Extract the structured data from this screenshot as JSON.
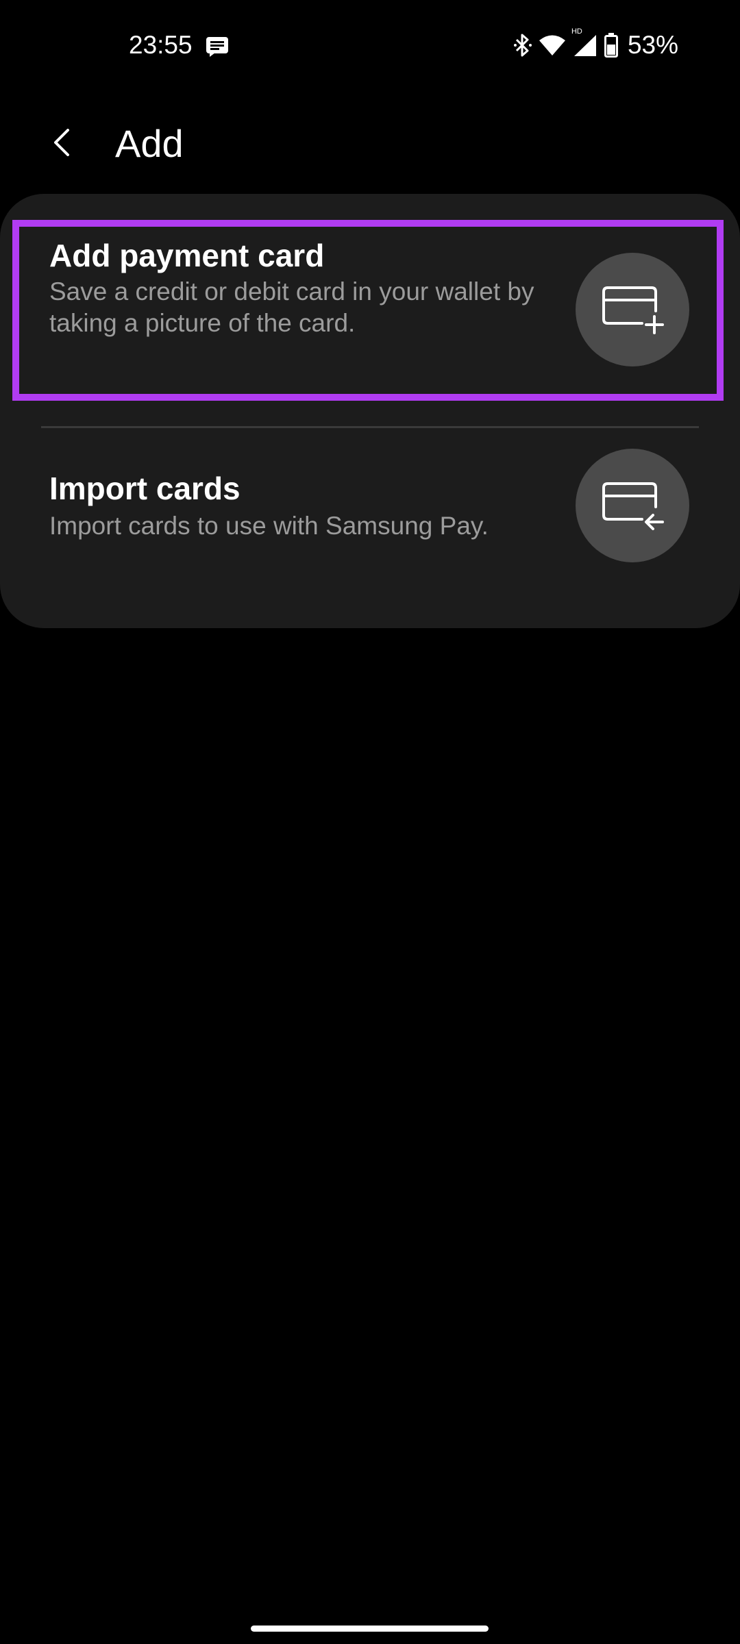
{
  "status_bar": {
    "time": "23:55",
    "battery_percent": "53%",
    "network_label": "HD",
    "icons": [
      "message-icon",
      "bluetooth-icon",
      "wifi-icon",
      "cellular-signal-icon",
      "battery-icon"
    ]
  },
  "header": {
    "title": "Add",
    "back_icon": "chevron-left-icon"
  },
  "options": [
    {
      "title": "Add payment card",
      "description": "Save a credit or debit card in your wallet by taking a picture of the card.",
      "icon": "card-add-icon",
      "highlighted": true
    },
    {
      "title": "Import cards",
      "description": "Import cards to use with Samsung Pay.",
      "icon": "card-import-icon",
      "highlighted": false
    }
  ],
  "colors": {
    "background": "#000000",
    "card_background": "#1c1c1c",
    "icon_circle": "#4b4b4b",
    "highlight": "#b13cf2",
    "secondary_text": "#9c9c9c"
  }
}
